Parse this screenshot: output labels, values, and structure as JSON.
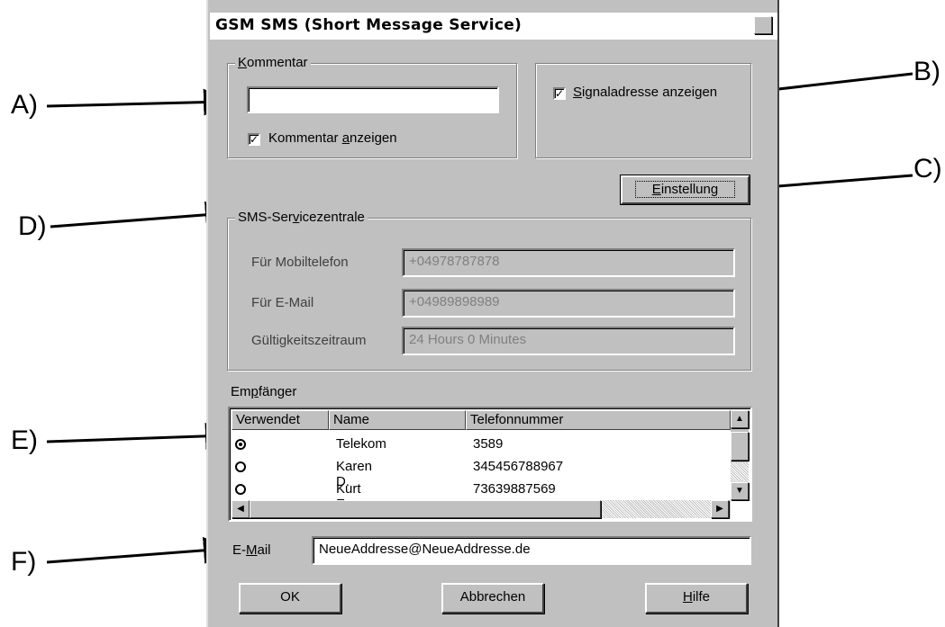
{
  "annotations": {
    "a": "A)",
    "b": "B)",
    "c": "C)",
    "d": "D)",
    "e": "E)",
    "f": "F)"
  },
  "window": {
    "title": "GSM SMS (Short Message Service)",
    "close_glyph": "✕"
  },
  "kommentar": {
    "legend_prefix": "K",
    "legend_rest": "ommentar",
    "value": "",
    "show_label_pre": "Kommentar ",
    "show_label_u": "a",
    "show_label_post": "nzeigen",
    "show_checked": true
  },
  "signal": {
    "label_u": "S",
    "label_rest": "ignaladresse anzeigen",
    "checked": true
  },
  "einstellung": {
    "label_u": "E",
    "label_rest": "instellung"
  },
  "servicezentrale": {
    "legend_pre": "SMS-Ser",
    "legend_u": "v",
    "legend_post": "icezentrale",
    "rows": [
      {
        "label": "Für Mobiltelefon",
        "value": "+04978787878"
      },
      {
        "label": "Für E-Mail",
        "value": "+04989898989"
      },
      {
        "label": "Gültigkeitszeitraum",
        "value": "24 Hours 0 Minutes"
      }
    ]
  },
  "empfaenger": {
    "label_pre": "Em",
    "label_u": "p",
    "label_post": "fänger",
    "columns": [
      "Verwendet",
      "Name",
      "Telefonnummer"
    ],
    "rows": [
      {
        "used": true,
        "name": "Telekom",
        "phone": "3589"
      },
      {
        "used": false,
        "name": "Karen D.",
        "phone": "345456788967"
      },
      {
        "used": false,
        "name": "Kurt E.",
        "phone": "73639887569"
      }
    ]
  },
  "email": {
    "label_pre": "E-",
    "label_u": "M",
    "label_post": "ail",
    "value": "NeueAddresse@NeueAddresse.de"
  },
  "buttons": {
    "ok": "OK",
    "cancel": "Abbrechen",
    "help_u": "H",
    "help_rest": "ilfe"
  },
  "icons": {
    "checkmark": "✓",
    "scroll_up": "▲",
    "scroll_down": "▼",
    "scroll_left": "◀",
    "scroll_right": "▶"
  }
}
